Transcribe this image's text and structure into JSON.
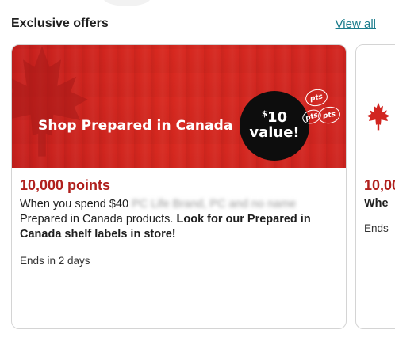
{
  "section": {
    "title": "Exclusive offers",
    "view_all_label": "View all"
  },
  "offer_main": {
    "banner_title": "Shop Prepared in Canada",
    "value_amount": "10",
    "value_currency": "$",
    "value_label": "value!",
    "badge_text": "pts",
    "points": "10,000 points",
    "desc_prefix": "When you spend $40",
    "desc_blurred": " PC Life Brand, PC and no name",
    "desc_middle": "Prepared in Canada products. ",
    "desc_bold": "Look for our Prepared in Canada shelf labels in store!",
    "ends": "Ends in 2 days"
  },
  "offer_next": {
    "points": "10,00",
    "desc": "Whe",
    "ends": "Ends"
  },
  "colors": {
    "brand_red": "#d22520",
    "points_red": "#b0201d",
    "link_teal": "#1c7c8c"
  },
  "icons": {
    "banner_leaf": "maple-leaf-icon",
    "next_leaf": "maple-leaf-icon",
    "badge": "pts-badge-icon"
  }
}
